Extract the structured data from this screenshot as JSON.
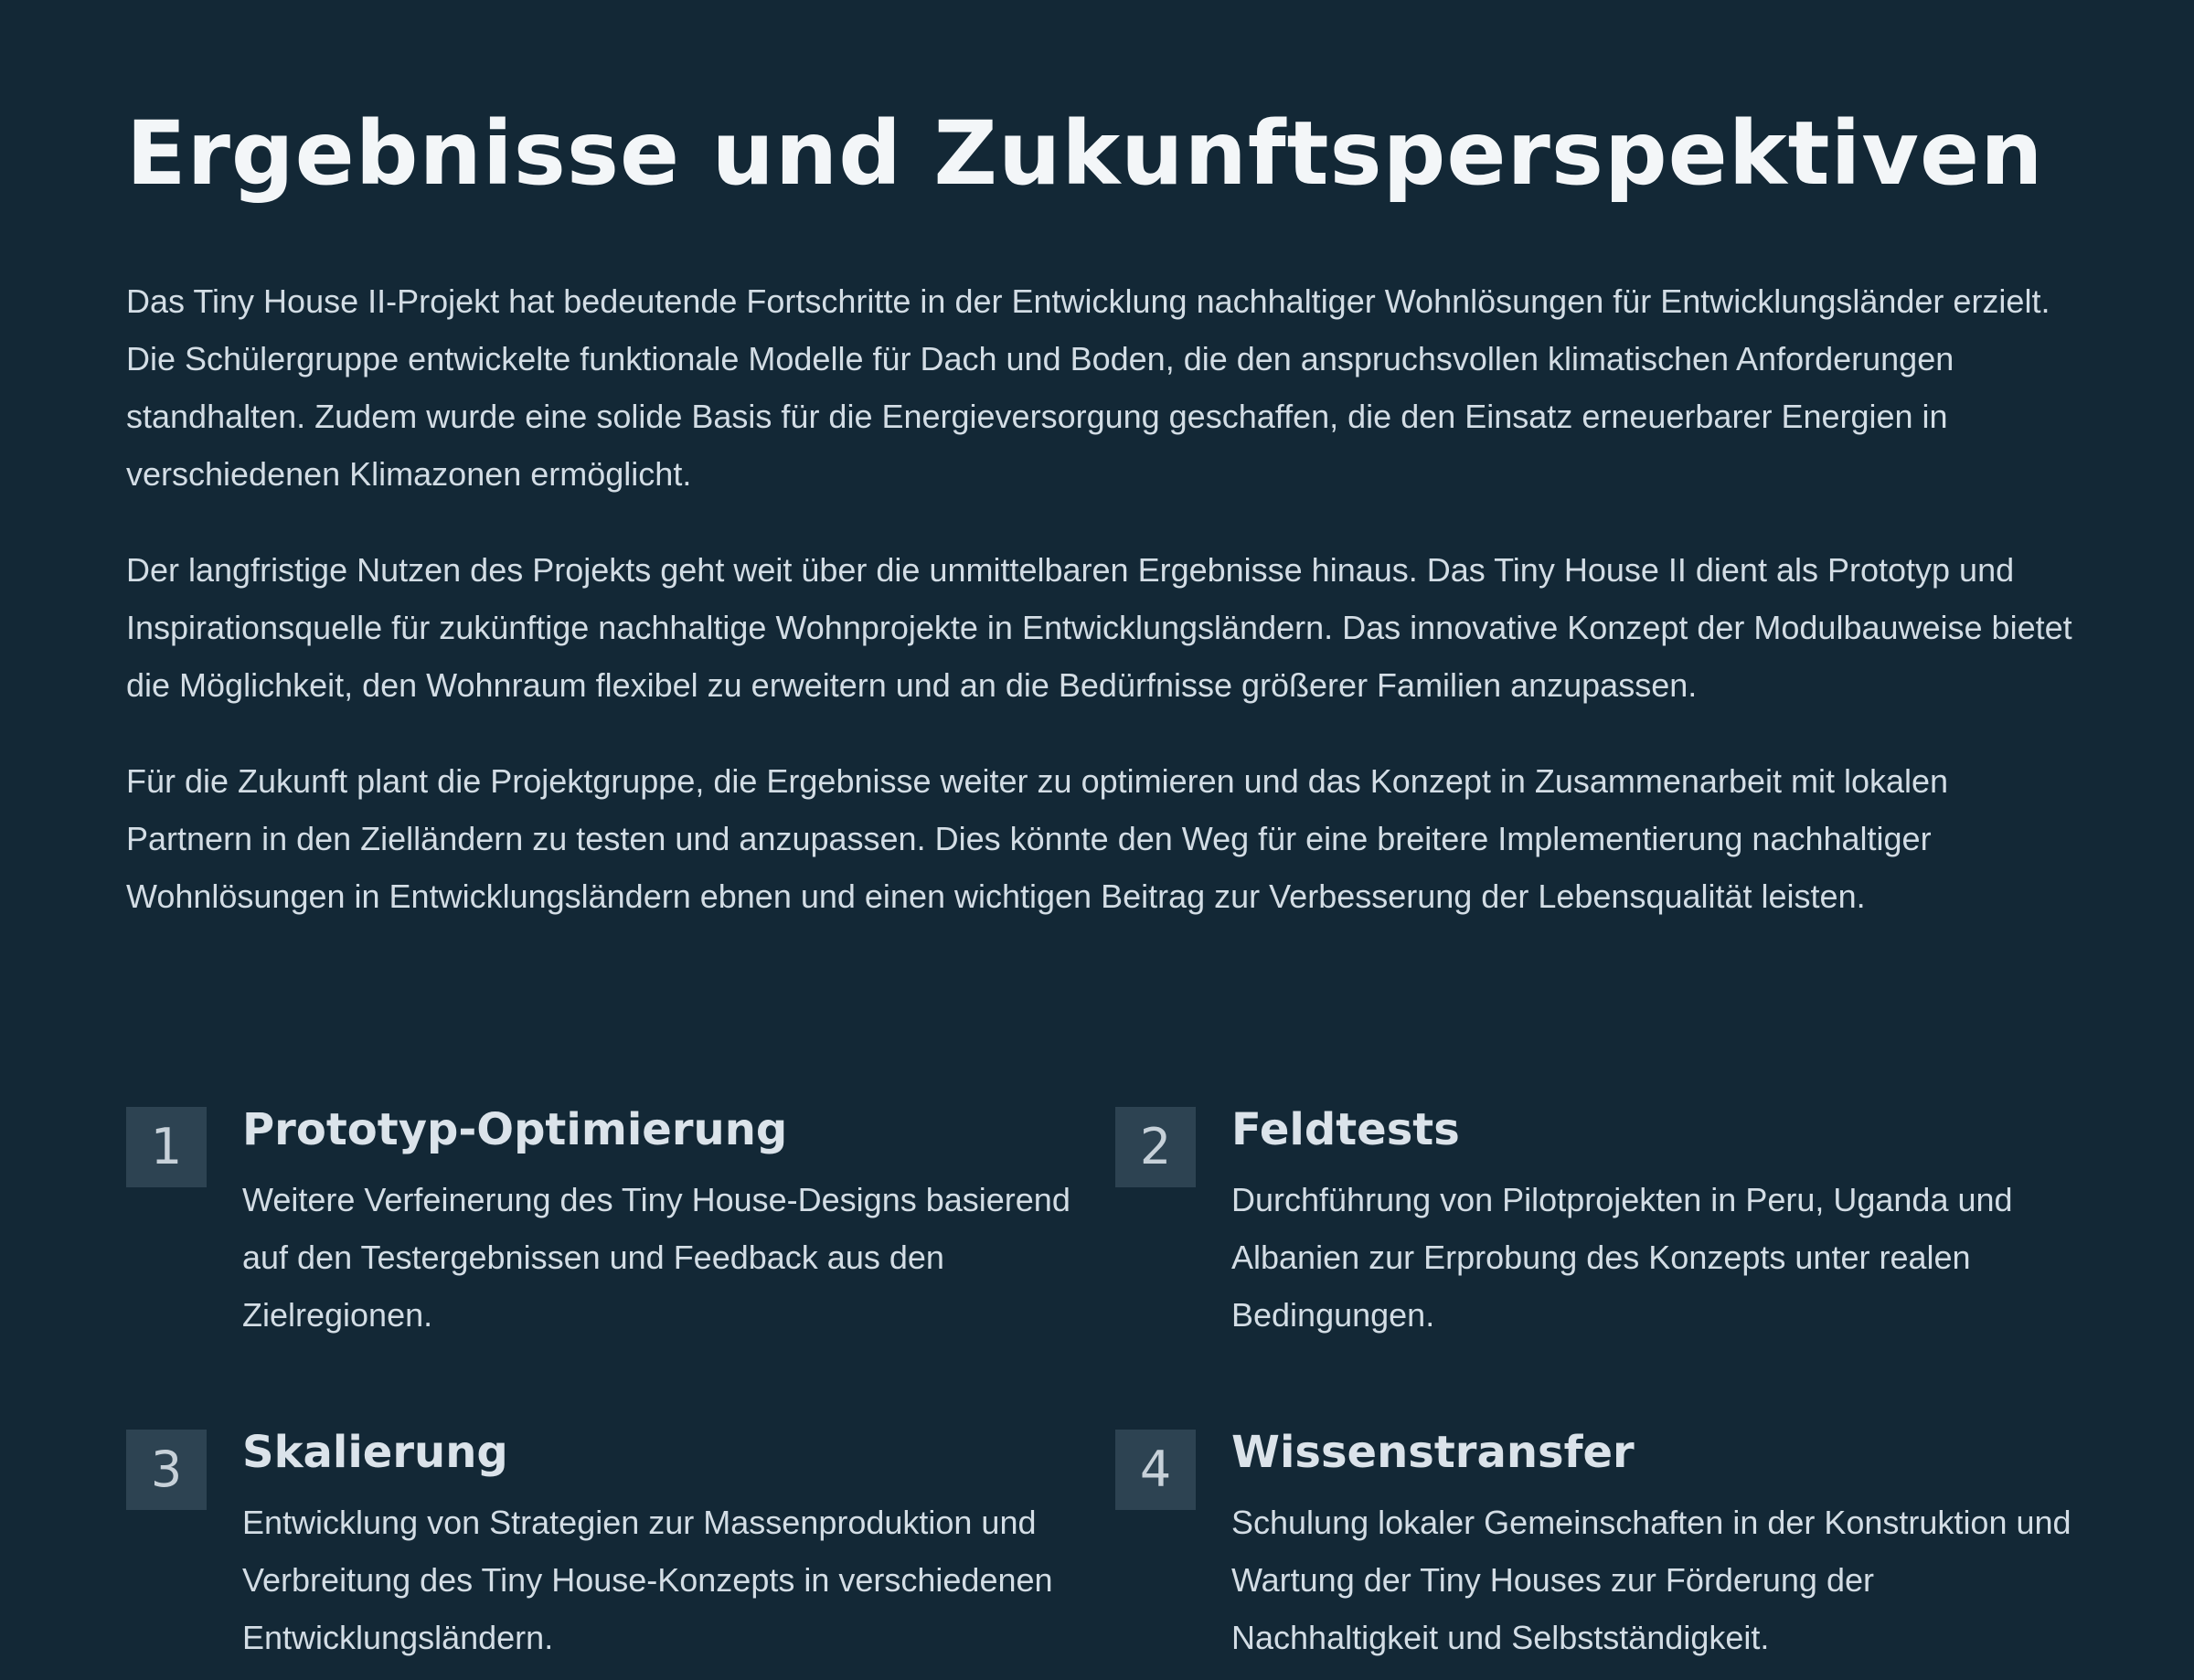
{
  "page": {
    "title": "Ergebnisse und Zukunftsperspektiven",
    "paragraphs": [
      "Das Tiny House II-Projekt hat bedeutende Fortschritte in der Entwicklung nachhaltiger Wohnlösungen für Entwicklungsländer erzielt. Die Schülergruppe entwickelte funktionale Modelle für Dach und Boden, die den anspruchsvollen klimatischen Anforderungen standhalten. Zudem wurde eine solide Basis für die Energieversorgung geschaffen, die den Einsatz erneuerbarer Energien in verschiedenen Klimazonen ermöglicht.",
      "Der langfristige Nutzen des Projekts geht weit über die unmittelbaren Ergebnisse hinaus. Das Tiny House II dient als Prototyp und Inspirationsquelle für zukünftige nachhaltige Wohnprojekte in Entwicklungsländern. Das innovative Konzept der Modulbauweise bietet die Möglichkeit, den Wohnraum flexibel zu erweitern und an die Bedürfnisse größerer Familien anzupassen.",
      "Für die Zukunft plant die Projektgruppe, die Ergebnisse weiter zu optimieren und das Konzept in Zusammenarbeit mit lokalen Partnern in den Zielländern zu testen und anzupassen. Dies könnte den Weg für eine breitere Implementierung nachhaltiger Wohnlösungen in Entwicklungsländern ebnen und einen wichtigen Beitrag zur Verbesserung der Lebensqualität leisten."
    ]
  },
  "steps": [
    {
      "number": "1",
      "title": "Prototyp-Optimierung",
      "text": "Weitere Verfeinerung des Tiny House-Designs basierend auf den Testergebnissen und Feedback aus den Zielregionen."
    },
    {
      "number": "2",
      "title": "Feldtests",
      "text": "Durchführung von Pilotprojekten in Peru, Uganda und Albanien zur Erprobung des Konzepts unter realen Bedingungen."
    },
    {
      "number": "3",
      "title": "Skalierung",
      "text": "Entwicklung von Strategien zur Massenproduktion und Verbreitung des Tiny House-Konzepts in verschiedenen Entwicklungsländern."
    },
    {
      "number": "4",
      "title": "Wissenstransfer",
      "text": "Schulung lokaler Gemeinschaften in der Konstruktion und Wartung der Tiny Houses zur Förderung der Nachhaltigkeit und Selbstständigkeit."
    }
  ],
  "colors": {
    "background": "#132836",
    "heading": "#f3f6f8",
    "body_text": "#d3dde5",
    "number_badge": "#2d4352"
  }
}
